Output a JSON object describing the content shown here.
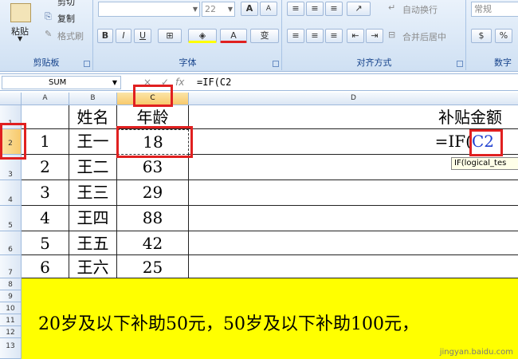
{
  "ribbon": {
    "clipboard": {
      "paste_label": "粘贴",
      "cut_label": "剪切",
      "copy_label": "复制",
      "format_painter_label": "格式刷",
      "group_label": "剪贴板"
    },
    "font": {
      "font_size_value": "22",
      "grow_label": "A",
      "shrink_label": "A",
      "bold": "B",
      "italic": "I",
      "underline": "U",
      "font_color": "A",
      "phonetic": "变",
      "group_label": "字体"
    },
    "alignment": {
      "wrap_text_label": "自动换行",
      "merge_center_label": "合并后居中",
      "group_label": "对齐方式"
    },
    "number": {
      "format_value": "常规",
      "percent": "%",
      "group_label": "数字"
    }
  },
  "formula_bar": {
    "name_box": "SUM",
    "cancel": "×",
    "enter": "✓",
    "fx": "fx",
    "formula": "=IF(C2"
  },
  "sheet": {
    "columns": [
      "A",
      "B",
      "C",
      "D"
    ],
    "row_numbers": [
      "1",
      "2",
      "3",
      "4",
      "5",
      "6",
      "7",
      "8",
      "9",
      "10",
      "11",
      "12",
      "13"
    ],
    "header_row": {
      "b": "姓名",
      "c": "年龄",
      "d": "补贴金额"
    },
    "rows": [
      {
        "a": "1",
        "b": "王一",
        "c": "18",
        "d": "=IF(C2"
      },
      {
        "a": "2",
        "b": "王二",
        "c": "63",
        "d": ""
      },
      {
        "a": "3",
        "b": "王三",
        "c": "29",
        "d": ""
      },
      {
        "a": "4",
        "b": "王四",
        "c": "88",
        "d": ""
      },
      {
        "a": "5",
        "b": "王五",
        "c": "42",
        "d": ""
      },
      {
        "a": "6",
        "b": "王六",
        "c": "25",
        "d": ""
      }
    ],
    "note": "20岁及以下补助50元，50岁及以下补助100元，",
    "edit_text_prefix": "=IF(",
    "edit_text_ref": "C2",
    "tooltip": "IF(logical_tes"
  },
  "watermark": "jingyan.baidu.com",
  "colors": {
    "highlight": "#ffff00",
    "annotation": "#e02020",
    "ref": "#1f3fd0"
  }
}
